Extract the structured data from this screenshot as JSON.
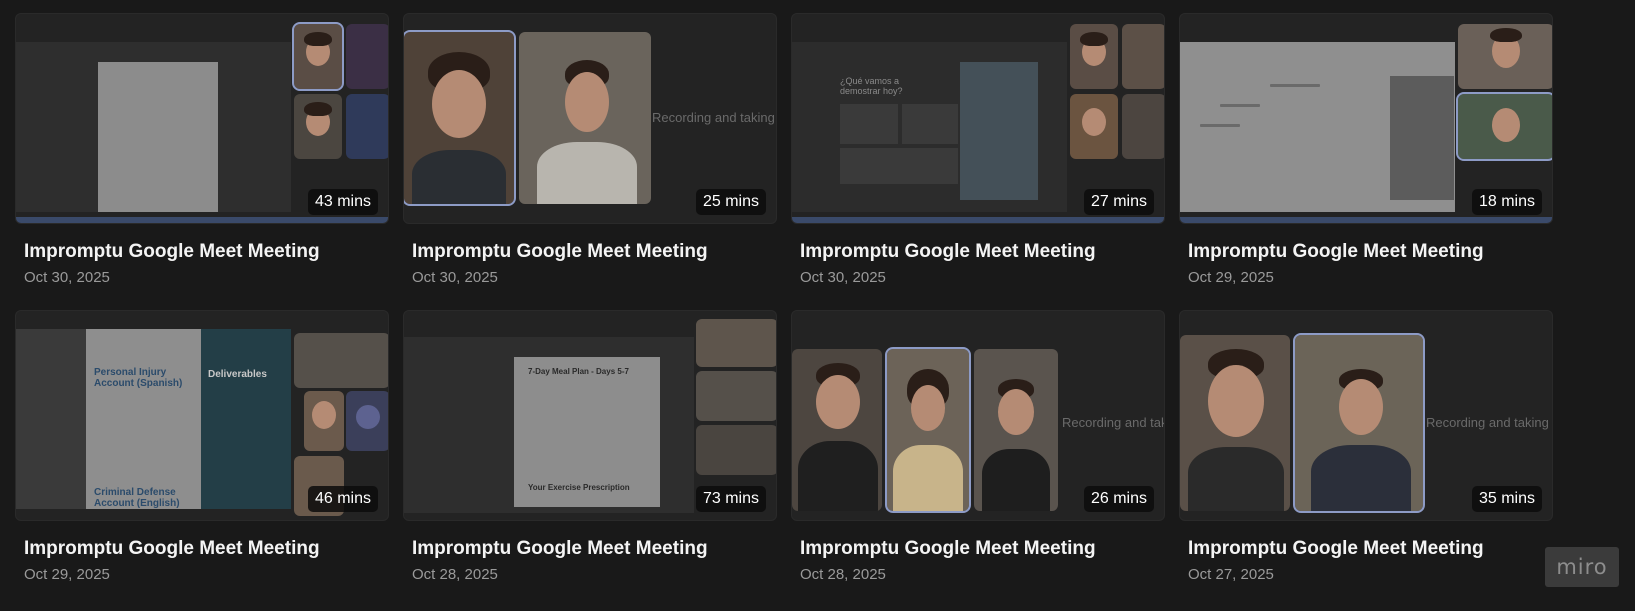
{
  "meetings": [
    {
      "title": "Impromptu Google Meet Meeting",
      "date": "Oct 30, 2025",
      "duration": "43 mins"
    },
    {
      "title": "Impromptu Google Meet Meeting",
      "date": "Oct 30, 2025",
      "duration": "25 mins"
    },
    {
      "title": "Impromptu Google Meet Meeting",
      "date": "Oct 30, 2025",
      "duration": "27 mins"
    },
    {
      "title": "Impromptu Google Meet Meeting",
      "date": "Oct 29, 2025",
      "duration": "18 mins"
    },
    {
      "title": "Impromptu Google Meet Meeting",
      "date": "Oct 29, 2025",
      "duration": "46 mins"
    },
    {
      "title": "Impromptu Google Meet Meeting",
      "date": "Oct 28, 2025",
      "duration": "73 mins"
    },
    {
      "title": "Impromptu Google Meet Meeting",
      "date": "Oct 28, 2025",
      "duration": "26 mins"
    },
    {
      "title": "Impromptu Google Meet Meeting",
      "date": "Oct 27, 2025",
      "duration": "35 mins"
    }
  ],
  "thumb_text": {
    "recording_1": "Recording and taking n",
    "recording_2": "Recording and taking",
    "recording_3": "Recording and taking n",
    "meal_plan": "7-Day Meal Plan - Days 5-7",
    "exercise": "Your Exercise Prescription",
    "demo_question": "¿Qué vamos a demostrar hoy?",
    "pi_heading": "Personal Injury Account (Spanish)",
    "cd_heading": "Criminal Defense Account (English)",
    "deliverables": "Deliverables"
  },
  "watermark": "miro"
}
